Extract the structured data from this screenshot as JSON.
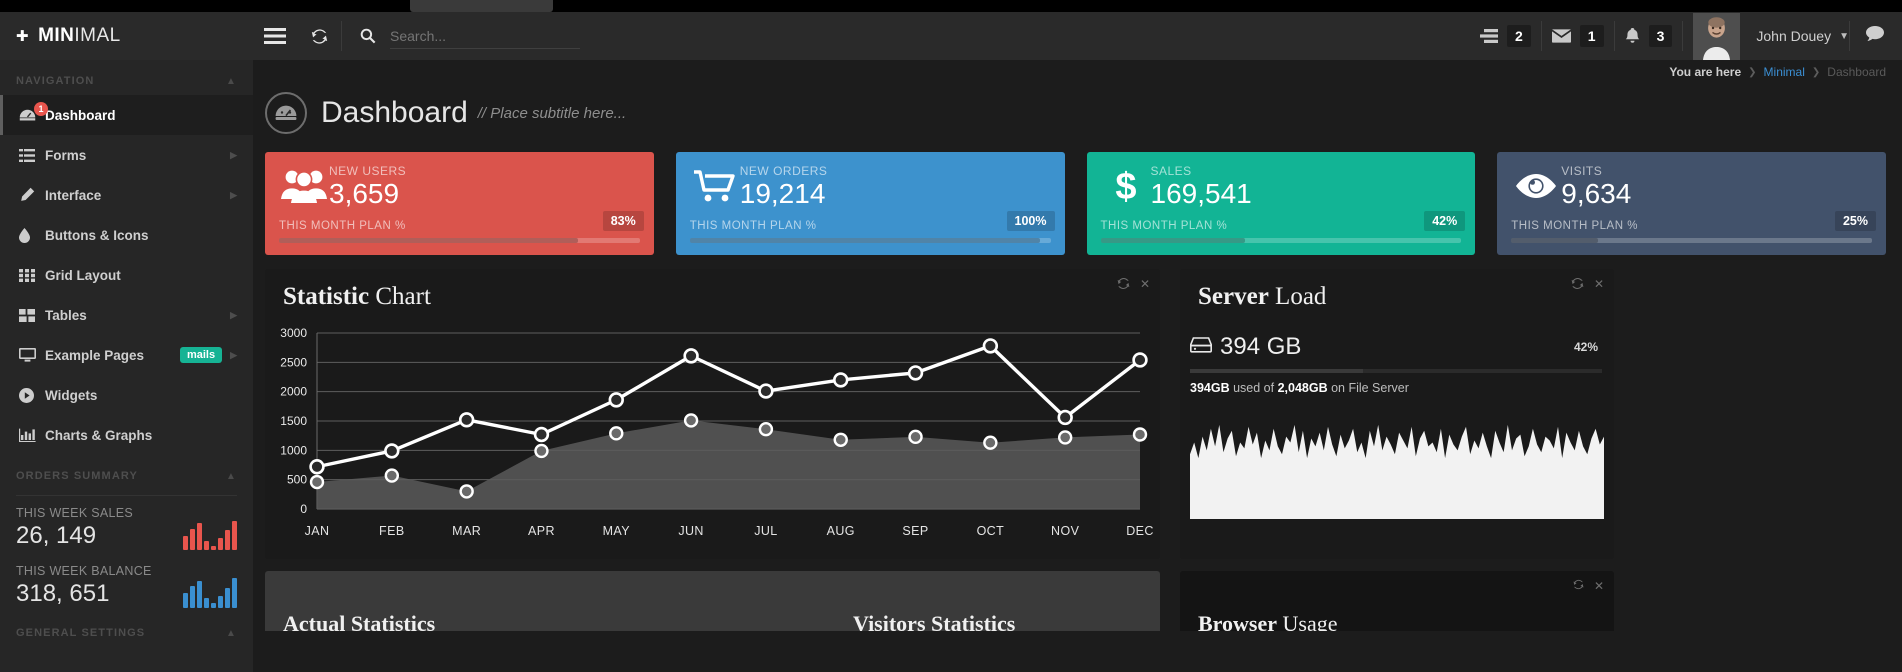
{
  "header": {
    "brand_bold": "MIN",
    "brand_light": "IMAL",
    "logo_icon": "crosshair-icon",
    "menu_icon": "hamburger-icon",
    "refresh_icon": "refresh-icon",
    "search_icon": "search-icon",
    "search_placeholder": "Search...",
    "search_value": "",
    "stats": [
      {
        "icon": "tasks-icon",
        "count": "2"
      },
      {
        "icon": "envelope-icon",
        "count": "1"
      },
      {
        "icon": "bell-icon",
        "count": "3"
      }
    ],
    "user_name": "John Douey",
    "caret_icon": "chevron-down-icon",
    "chat_icon": "chat-bubble-icon"
  },
  "sidebar": {
    "nav_heading": "NAVIGATION",
    "items": [
      {
        "label": "Dashboard",
        "icon": "dashboard-icon",
        "badge": "1",
        "active": true
      },
      {
        "label": "Forms",
        "icon": "list-icon",
        "arrow": true
      },
      {
        "label": "Interface",
        "icon": "pencil-icon",
        "arrow": true
      },
      {
        "label": "Buttons & Icons",
        "icon": "droplet-icon"
      },
      {
        "label": "Grid Layout",
        "icon": "grid-icon"
      },
      {
        "label": "Tables",
        "icon": "table-icon",
        "arrow": true
      },
      {
        "label": "Example Pages",
        "icon": "monitor-icon",
        "pill": "mails",
        "arrow": true
      },
      {
        "label": "Widgets",
        "icon": "play-circle-icon"
      },
      {
        "label": "Charts & Graphs",
        "icon": "bar-chart-icon"
      }
    ],
    "orders_heading": "ORDERS SUMMARY",
    "summaries": [
      {
        "label": "THIS WEEK SALES",
        "value": "26, 149",
        "color": "#e8554d",
        "bars": [
          40,
          62,
          78,
          26,
          12,
          34,
          58,
          86
        ]
      },
      {
        "label": "THIS WEEK BALANCE",
        "value": "318, 651",
        "color": "#3a8fd0",
        "bars": [
          44,
          66,
          80,
          28,
          14,
          36,
          60,
          88
        ]
      }
    ],
    "general_heading": "GENERAL SETTINGS"
  },
  "breadcrumb": {
    "prefix": "You are here",
    "link": "Minimal",
    "current": "Dashboard",
    "separator": "❯"
  },
  "page": {
    "title": "Dashboard",
    "subtitle": "// Place subtitle here...",
    "icon": "gauge-icon"
  },
  "cards": [
    {
      "label": "NEW USERS",
      "value": "3,659",
      "plan_label": "THIS MONTH PLAN %",
      "pct": "83%",
      "pct_num": 83,
      "bg": "#da544c",
      "icon": "users-icon"
    },
    {
      "label": "NEW ORDERS",
      "value": "19,214",
      "plan_label": "THIS MONTH PLAN %",
      "pct": "100%",
      "pct_num": 97,
      "bg": "#3d92cd",
      "icon": "cart-icon"
    },
    {
      "label": "SALES",
      "value": "169,541",
      "plan_label": "THIS MONTH PLAN %",
      "pct": "42%",
      "pct_num": 40,
      "bg": "#12b495",
      "icon": "dollar-icon"
    },
    {
      "label": "VISITS",
      "value": "9,634",
      "plan_label": "THIS MONTH PLAN %",
      "pct": "25%",
      "pct_num": 24,
      "bg": "#42526b",
      "icon": "eye-icon"
    }
  ],
  "statistic_panel": {
    "title_bold": "Statistic",
    "title_light": " Chart",
    "refresh_icon": "refresh-icon",
    "close_icon": "close-icon"
  },
  "server_panel": {
    "title_bold": "Server",
    "title_light": " Load",
    "refresh_icon": "refresh-icon",
    "close_icon": "close-icon",
    "disk_icon": "hdd-icon",
    "capacity": "394 GB",
    "pct": "42%",
    "pct_num": 42,
    "used_bold": "394GB",
    "used_mid": " used of ",
    "total_bold": "2,048GB",
    "used_tail": " on File Server"
  },
  "bottom_panels": [
    {
      "title": "Actual Statistics",
      "theme": "light"
    },
    {
      "title": "Visitors Statistics",
      "theme": "light"
    },
    {
      "title_bold": "Browser",
      "title_light": " Usage",
      "theme": "dark",
      "refresh_icon": "refresh-icon",
      "close_icon": "close-icon"
    }
  ],
  "chart_data": {
    "type": "line",
    "title": "Statistic Chart",
    "categories": [
      "JAN",
      "FEB",
      "MAR",
      "APR",
      "MAY",
      "JUN",
      "JUL",
      "AUG",
      "SEP",
      "OCT",
      "NOV",
      "DEC"
    ],
    "series": [
      {
        "name": "primary",
        "style": "line",
        "color": "#ffffff",
        "values": [
          720,
          990,
          1520,
          1270,
          1860,
          2610,
          2010,
          2200,
          2320,
          2780,
          1560,
          2540
        ]
      },
      {
        "name": "secondary",
        "style": "area",
        "color": "#5a5a5a",
        "values": [
          460,
          570,
          300,
          990,
          1290,
          1510,
          1360,
          1180,
          1230,
          1130,
          1220,
          1270
        ]
      }
    ],
    "ylim": [
      0,
      3000
    ],
    "yticks": [
      0,
      500,
      1000,
      1500,
      2000,
      2500,
      3000
    ],
    "xlabel": "",
    "ylabel": "",
    "grid": true,
    "legend": "none"
  },
  "server_sparkline": {
    "type": "area",
    "values": [
      62,
      74,
      58,
      80,
      66,
      88,
      70,
      92,
      64,
      78,
      86,
      60,
      74,
      68,
      90,
      72,
      84,
      58,
      76,
      66,
      88,
      70,
      62,
      80,
      74,
      92,
      64,
      86,
      58,
      78,
      70,
      84,
      66,
      90,
      72,
      60,
      82,
      68,
      76,
      88,
      64,
      74,
      58,
      86,
      70,
      92,
      66,
      80,
      72,
      62,
      84,
      76,
      68,
      90,
      60,
      78,
      86,
      70,
      74,
      64,
      88,
      58,
      82,
      72,
      66,
      80,
      90,
      62,
      76,
      68,
      84,
      70,
      58,
      86,
      74,
      64,
      92,
      66,
      78,
      82,
      60,
      70,
      88,
      72,
      64,
      80,
      76,
      68,
      90,
      58,
      84,
      74,
      66,
      86,
      70,
      62,
      78,
      88,
      72,
      80
    ]
  }
}
